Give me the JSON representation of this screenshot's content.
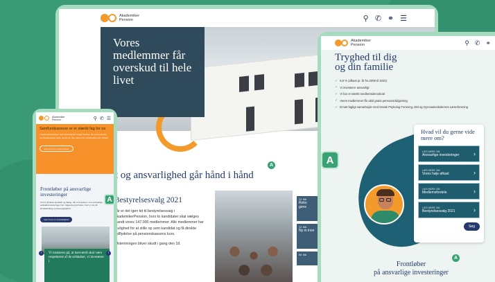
{
  "brand": {
    "name_line1": "Akademiker",
    "name_line2": "Pension"
  },
  "colors": {
    "orange": "#f39a2c",
    "navy": "#26396d",
    "green": "#3aa174",
    "teal": "#1f5c6e"
  },
  "icons": [
    "search-icon",
    "phone-icon",
    "lock-icon",
    "menu-icon"
  ],
  "desktop": {
    "hero_title": "Vores medlemmer får overskud til hele livet",
    "section_heading": "Fast og ansvarlighed går hånd i hånd",
    "election": {
      "title": "Bestyrelsesvalg 2021",
      "p1": "I år er det igen tid til bestyrelsesvalg i AkademikerPension, hvor to kandidater skal vælges blandt vores 147.000 medlemmer. Alle medlemmer har mulighed for at stille op som kandidat og få direkte indflydelse på pensionskassens kurs.",
      "p2": "Afstemningen bliver skudt i gang den 18."
    },
    "side_cards": [
      {
        "label": "12. MA",
        "text": "Reko gene"
      },
      {
        "label": "12. MA",
        "text": "Ny m inve"
      },
      {
        "label": "06. MA",
        "text": ""
      }
    ]
  },
  "tablet": {
    "title_line1": "Tryghed til dig",
    "title_line2": "og din familie",
    "checks": [
      "8,9 % (afkast pr. år fra 2008 til 2020)",
      "Vi investerer ansvarligt",
      "Vi har et stærkt medlemsdemokrati",
      "Vores medlemmer får altid gratis pensionsrådgivning",
      "Et tæt fagligt samarbejde med Dansk Psykolog Forening, DM og Gymnasieskolernes Lærerforening"
    ],
    "card_title": "Hvad vil du gerne vide mere om?",
    "tiles": [
      {
        "kicker": "LÆS MERE OM",
        "text": "Ansvarlige investeringer"
      },
      {
        "kicker": "LÆS MERE OM",
        "text": "Vores høje afkast"
      },
      {
        "kicker": "LÆS MERE OM",
        "text": "Medlemsfordele"
      },
      {
        "kicker": "LÆS MERE OM",
        "text": "Bestyrelsesvalg 2021"
      }
    ],
    "search_button": "Søg",
    "footer_line1": "Frontløber",
    "footer_line2": "på ansvarlige investeringer"
  },
  "phone": {
    "banner_title": "Samfundsansvar er et stærkt fag for os",
    "banner_text": "I AkademikerPension skal ansvarlighed bruges ikonisk, da vores pension samfundsudvikler tager ansvar for den rolle og for samfundets som helhed.",
    "banner_link": "Læs mere om vores ansvar",
    "section_title": "Frontløber på ansvarlige investeringer",
    "section_text": "Vi tror på aktivt ejerskab og dialog, når vi investerer, men ansvarlige selskabsinvesteringer har i stigende grad fokus, hvor vi tror på klimahandling og bæredygtighed.",
    "cta": "Læs mere om ansvarlighed",
    "quote": "Vi insisterer på, at merværdi skal være respekteret af de selskaber, vi investerer i."
  },
  "badge_letter": "A"
}
